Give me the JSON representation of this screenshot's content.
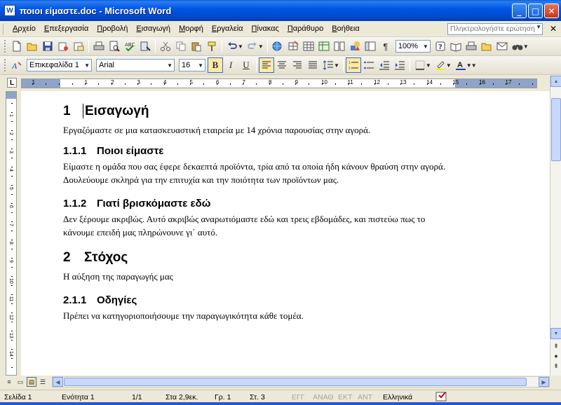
{
  "window": {
    "app_icon": "W",
    "title": "ποιοι είμαστε.doc - Microsoft Word",
    "minimize_glyph": "_",
    "maximize_glyph": "□",
    "close_glyph": "✕"
  },
  "menu": {
    "items": [
      {
        "u": "Α",
        "rest": "ρχείο"
      },
      {
        "u": "Ε",
        "rest": "πεξεργασία"
      },
      {
        "u": "Π",
        "rest": "ροβολή"
      },
      {
        "u": "Ε",
        "rest": "ισαγωγή"
      },
      {
        "u": "Μ",
        "rest": "ορφή"
      },
      {
        "u": "Ε",
        "rest": "ργαλεία"
      },
      {
        "u": "Π",
        "rest": "ίνακας"
      },
      {
        "u": "Π",
        "rest": "αράθυρο"
      },
      {
        "u": "Β",
        "rest": "οήθεια"
      }
    ],
    "ask_placeholder": "Πληκτρολογήστε ερώτηση",
    "doc_close": "✕"
  },
  "toolbar_standard": {
    "zoom": "100%",
    "show_formatting_glyph": "¶"
  },
  "toolbar_formatting": {
    "style": "Επικεφαλίδα 1",
    "font": "Arial",
    "size": "16",
    "bold": "B",
    "italic": "I",
    "underline": "U",
    "bold_active": true,
    "align_left_active": true,
    "numbering_active": true
  },
  "ruler": {
    "corner_glyph": "L",
    "numbers": [
      "1",
      "1",
      "2",
      "3",
      "4",
      "5",
      "6",
      "7",
      "8",
      "9",
      "10",
      "11",
      "12",
      "13",
      "14",
      "15",
      "16",
      "17"
    ],
    "v_numbers": [
      "1",
      "2",
      "3",
      "4",
      "5",
      "6",
      "7",
      "8",
      "9",
      "10",
      "11",
      "12",
      "13",
      "14",
      "15"
    ]
  },
  "document": {
    "h1_1": {
      "num": "1",
      "text": "Εισαγωγή"
    },
    "p1": "Εργαζόμαστε σε μια κατασκευαστική εταιρεία με 14 χρόνια παρουσίας στην αγορά.",
    "h2_1": {
      "num": "1.1.1",
      "text": "Ποιοι είμαστε"
    },
    "p2": "Είμαστε η ομάδα που σας έφερε δεκαεπτά προϊόντα, τρία από τα οποία ήδη κάνουν θραύση στην αγορά. Δουλεύουμε σκληρά για την επιτυχία και την ποιότητα των προϊόντων μας.",
    "h2_2": {
      "num": "1.1.2",
      "text": "Γιατί βρισκόμαστε εδώ"
    },
    "p3": "Δεν ξέρουμε ακριβώς. Αυτό ακριβώς αναρωτιόμαστε εδώ και τρεις εβδομάδες, και πιστεύω πως το κάνουμε επειδή μας πληρώνουνε γι΄ αυτό.",
    "h1_2": {
      "num": "2",
      "text": "Στόχος"
    },
    "p4": "Η αύξηση της παραγωγής μας",
    "h2_3": {
      "num": "2.1.1",
      "text": "Οδηγίες"
    },
    "p5": "Πρέπει να κατηγοριοποιήσουμε την παραγωγικότητα κάθε τομέα."
  },
  "status": {
    "page": "Σελίδα 1",
    "section": "Ενότητα 1",
    "pages": "1/1",
    "at": "Στα 2,9εκ.",
    "line": "Γρ. 1",
    "col": "Στ. 3",
    "rec": "ΕΓΓ",
    "trk": "ΑΝΑΘ",
    "ext": "ΕΚΤ",
    "ovr": "ΑΝΤ",
    "language": "Ελληνικά"
  },
  "icons": [
    "new-document-icon",
    "open-folder-icon",
    "save-icon",
    "permission-icon",
    "email-icon",
    "print-icon",
    "print-preview-icon",
    "spelling-icon",
    "research-icon",
    "cut-icon",
    "copy-icon",
    "paste-icon",
    "format-painter-icon",
    "undo-icon",
    "redo-icon",
    "hyperlink-icon",
    "tables-borders-icon",
    "insert-table-icon",
    "insert-excel-icon",
    "columns-icon",
    "drawing-icon",
    "document-map-icon",
    "show-formatting-icon",
    "help-icon",
    "styles-icon"
  ]
}
